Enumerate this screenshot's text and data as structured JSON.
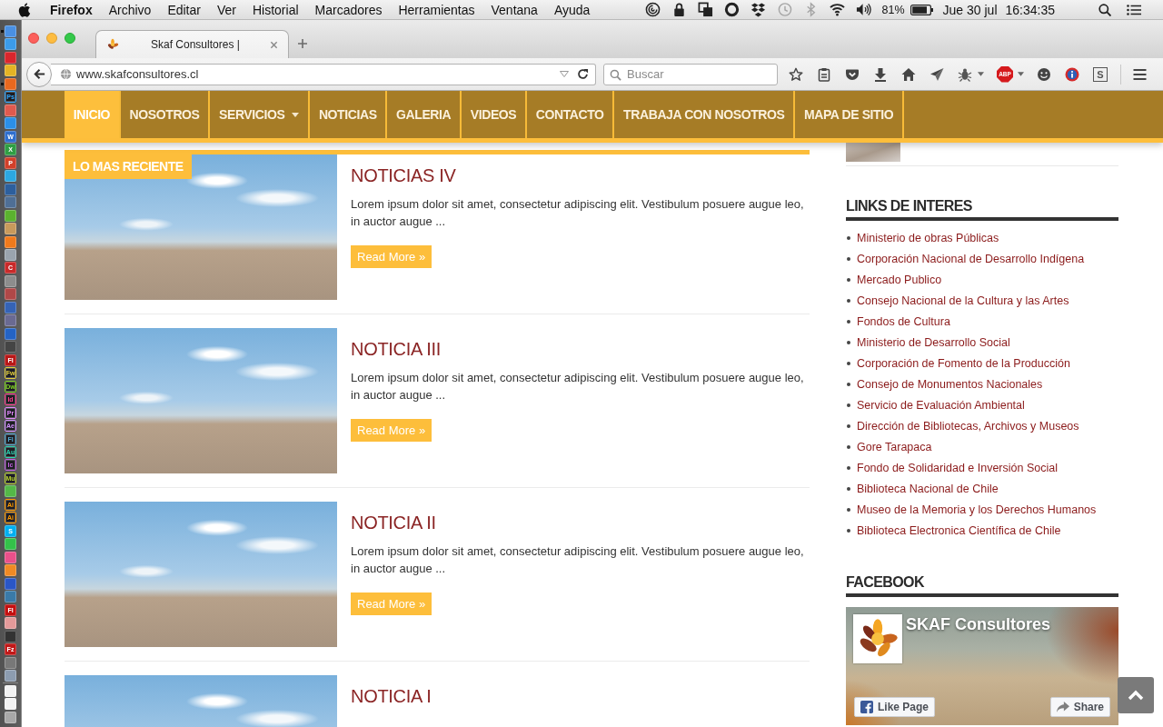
{
  "menubar": {
    "app": "Firefox",
    "menus": [
      "Archivo",
      "Editar",
      "Ver",
      "Historial",
      "Marcadores",
      "Herramientas",
      "Ventana",
      "Ayuda"
    ],
    "battery": "81%",
    "date": "Jue 30 jul",
    "time": "16:34:35"
  },
  "dock": {
    "items": [
      {
        "kind": "app",
        "color": "#4a90e2",
        "running": true
      },
      {
        "kind": "app",
        "color": "#3b9bea",
        "running": false
      },
      {
        "kind": "app",
        "color": "#d9262c",
        "running": false
      },
      {
        "kind": "app",
        "color": "#e4b425",
        "running": false
      },
      {
        "kind": "app",
        "color": "#e8681e",
        "running": true
      },
      {
        "kind": "adobe",
        "color": "#31a8ff",
        "label": "Ps",
        "running": false
      },
      {
        "kind": "app",
        "color": "#e05a4e",
        "running": false
      },
      {
        "kind": "app",
        "color": "#2b8fe8",
        "running": false
      },
      {
        "kind": "app",
        "color": "#2f6fcf",
        "label": "W",
        "running": false
      },
      {
        "kind": "app",
        "color": "#2f9e44",
        "label": "X",
        "running": false
      },
      {
        "kind": "app",
        "color": "#d1402a",
        "label": "P",
        "running": false
      },
      {
        "kind": "app",
        "color": "#2ca7e0",
        "running": false
      },
      {
        "kind": "app",
        "color": "#2d5f9c",
        "running": false
      },
      {
        "kind": "app",
        "color": "#4f6f95",
        "running": false
      },
      {
        "kind": "app",
        "color": "#5bb22f",
        "running": false
      },
      {
        "kind": "app",
        "color": "#c89a5c",
        "running": false
      },
      {
        "kind": "app",
        "color": "#f07a1c",
        "running": false
      },
      {
        "kind": "app",
        "color": "#9aa4ae",
        "running": false
      },
      {
        "kind": "app",
        "color": "#c92a2a",
        "label": "C",
        "running": false
      },
      {
        "kind": "app",
        "color": "#8d8d8d",
        "running": false
      },
      {
        "kind": "app",
        "color": "#b04848",
        "running": false
      },
      {
        "kind": "app",
        "color": "#3563b5",
        "running": false
      },
      {
        "kind": "app",
        "color": "#6a6a92",
        "running": false
      },
      {
        "kind": "app",
        "color": "#2463c4",
        "running": false
      },
      {
        "kind": "app",
        "color": "#454545",
        "running": false
      },
      {
        "kind": "app",
        "color": "#b81818",
        "label": "Fl",
        "running": false
      },
      {
        "kind": "adobe",
        "color": "#e6d13c",
        "label": "Fw",
        "running": false
      },
      {
        "kind": "adobe",
        "color": "#7ed321",
        "label": "Dw",
        "running": false
      },
      {
        "kind": "adobe",
        "color": "#ff3d8b",
        "label": "Id",
        "running": false
      },
      {
        "kind": "adobe",
        "color": "#e58aff",
        "label": "Pr",
        "running": false
      },
      {
        "kind": "adobe",
        "color": "#d291ff",
        "label": "Ae",
        "running": false
      },
      {
        "kind": "adobe",
        "color": "#4fa8d0",
        "label": "Fl",
        "running": false
      },
      {
        "kind": "adobe",
        "color": "#2bd6b3",
        "label": "Au",
        "running": false
      },
      {
        "kind": "adobe",
        "color": "#c060e0",
        "label": "Ic",
        "running": false
      },
      {
        "kind": "adobe",
        "color": "#b4d02a",
        "label": "Mu",
        "running": false
      },
      {
        "kind": "app",
        "color": "#54b848",
        "running": false
      },
      {
        "kind": "adobe",
        "color": "#ff9a00",
        "label": "Ai",
        "running": false
      },
      {
        "kind": "adobe",
        "color": "#ff9a00",
        "label": "Ai",
        "running": false
      },
      {
        "kind": "app",
        "color": "#00aff0",
        "label": "S",
        "running": false
      },
      {
        "kind": "app",
        "color": "#34c24a",
        "running": false
      },
      {
        "kind": "app",
        "color": "#e8508a",
        "running": false
      },
      {
        "kind": "app",
        "color": "#f08a24",
        "running": false
      },
      {
        "kind": "app",
        "color": "#2a56c6",
        "running": false
      },
      {
        "kind": "app",
        "color": "#3a7aa8",
        "running": false
      },
      {
        "kind": "app",
        "color": "#c41010",
        "label": "Fl",
        "running": false
      },
      {
        "kind": "app",
        "color": "#e39a9a",
        "running": false
      },
      {
        "kind": "app",
        "color": "#333333",
        "running": false
      },
      {
        "kind": "app",
        "color": "#c01818",
        "label": "Fz",
        "running": false
      },
      {
        "kind": "app",
        "color": "#787878",
        "running": false
      },
      {
        "kind": "app",
        "color": "#8c9cb0",
        "running": false
      },
      {
        "kind": "separator"
      },
      {
        "kind": "app",
        "color": "#f2f2f2",
        "running": false
      },
      {
        "kind": "app",
        "color": "#f2f2f2",
        "running": false
      },
      {
        "kind": "app",
        "color": "#a8a8a8",
        "running": false
      }
    ]
  },
  "browser": {
    "tab": {
      "title": "Skaf Consultores |"
    },
    "url": "www.skafconsultores.cl",
    "search": {
      "placeholder": "Buscar"
    },
    "abp_button": {
      "label": "ABP"
    },
    "s_button": {
      "label": "S"
    }
  },
  "site": {
    "nav": [
      {
        "label": "INICIO",
        "selected": true,
        "dropdown": false
      },
      {
        "label": "NOSOTROS",
        "selected": false,
        "dropdown": false
      },
      {
        "label": "SERVICIOS",
        "selected": false,
        "dropdown": true
      },
      {
        "label": "NOTICIAS",
        "selected": false,
        "dropdown": false
      },
      {
        "label": "GALERIA",
        "selected": false,
        "dropdown": false
      },
      {
        "label": "VIDEOS",
        "selected": false,
        "dropdown": false
      },
      {
        "label": "CONTACTO",
        "selected": false,
        "dropdown": false
      },
      {
        "label": "TRABAJA CON NOSOTROS",
        "selected": false,
        "dropdown": false
      },
      {
        "label": "MAPA DE SITIO",
        "selected": false,
        "dropdown": false
      }
    ],
    "posts": [
      {
        "featured": true,
        "badge": "LO MAS RECIENTE",
        "title": "NOTICIAS IV",
        "excerpt": "Lorem ipsum dolor sit amet, consectetur adipiscing elit. Vestibulum posuere augue leo, in auctor augue ...",
        "button": "Read More »"
      },
      {
        "featured": false,
        "title": "NOTICIA III",
        "excerpt": "Lorem ipsum dolor sit amet, consectetur adipiscing elit. Vestibulum posuere augue leo, in auctor augue ...",
        "button": "Read More »"
      },
      {
        "featured": false,
        "title": "NOTICIA II",
        "excerpt": "Lorem ipsum dolor sit amet, consectetur adipiscing elit. Vestibulum posuere augue leo, in auctor augue ...",
        "button": "Read More »"
      },
      {
        "featured": false,
        "title": "NOTICIA I"
      }
    ],
    "sidebar": {
      "links_heading": "LINKS DE INTERES",
      "links": [
        "Ministerio de obras Públicas",
        "Corporación Nacional de Desarrollo Indígena",
        "Mercado Publico",
        "Consejo Nacional de la Cultura y las Artes",
        "Fondos de Cultura",
        "Ministerio de Desarrollo Social",
        "Corporación de Fomento de la Producción",
        "Consejo de Monumentos Nacionales",
        "Servicio de Evaluación Ambiental",
        "Dirección de Bibliotecas, Archivos y Museos",
        "Gore Tarapaca",
        "Fondo de Solidaridad e Inversión Social",
        "Biblioteca Nacional de Chile",
        "Museo de la Memoria y los Derechos Humanos",
        "Biblioteca Electronica Científica de Chile"
      ],
      "facebook_heading": "FACEBOOK",
      "facebook": {
        "page_name": "SKAF Consultores",
        "like_button": "Like Page",
        "share_button": "Share"
      }
    }
  }
}
